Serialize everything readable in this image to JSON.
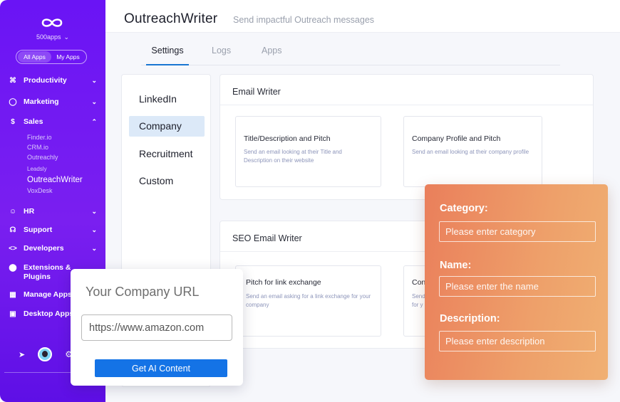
{
  "sidebar": {
    "org_name": "500apps",
    "toggle": {
      "all_apps": "All Apps",
      "my_apps": "My Apps"
    },
    "menu": {
      "productivity": "Productivity",
      "marketing": "Marketing",
      "sales": "Sales",
      "hr": "HR",
      "support": "Support",
      "developers": "Developers",
      "extensions": "Extensions & Plugins",
      "manage_apps": "Manage Apps",
      "desktop_apps": "Desktop Apps"
    },
    "sales_apps": {
      "finder": "Finder.io",
      "crm": "CRM.io",
      "outreachly": "Outreachly",
      "leadsly": "Leadsly",
      "outreachwriter": "OutreachWriter",
      "voxdesk": "VoxDesk"
    }
  },
  "header": {
    "title": "OutreachWriter",
    "subtitle": "Send impactful Outreach messages"
  },
  "tabs": {
    "settings": "Settings",
    "logs": "Logs",
    "apps": "Apps"
  },
  "categories": {
    "linkedin": "LinkedIn",
    "company": "Company",
    "recruitment": "Recruitment",
    "custom": "Custom"
  },
  "email_writer": {
    "title": "Email Writer",
    "card1": {
      "title": "Title/Description and Pitch",
      "desc": "Send an email looking at their Title and Description on their website"
    },
    "card2": {
      "title": "Company Profile and Pitch",
      "desc": "Send an email looking at their company profile"
    }
  },
  "seo_writer": {
    "title": "SEO Email Writer",
    "card1": {
      "title": "Pitch for link exchange",
      "desc": "Send an email asking for a link exchange for your company"
    },
    "card2": {
      "title": "Con",
      "desc": "Send\nfor y"
    }
  },
  "url_card": {
    "heading": "Your Company URL",
    "input_value": "https://www.amazon.com",
    "button": "Get AI Content"
  },
  "form_card": {
    "category_label": "Category:",
    "category_placeholder": "Please enter category",
    "name_label": "Name:",
    "name_placeholder": "Please enter the name",
    "description_label": "Description:",
    "description_placeholder": "Please enter description"
  },
  "colors": {
    "sidebar_gradient_top": "#6a14f5",
    "accent_blue": "#1473e6",
    "form_orange": "#ea7f5b",
    "active_category_bg": "#dce9f8"
  }
}
